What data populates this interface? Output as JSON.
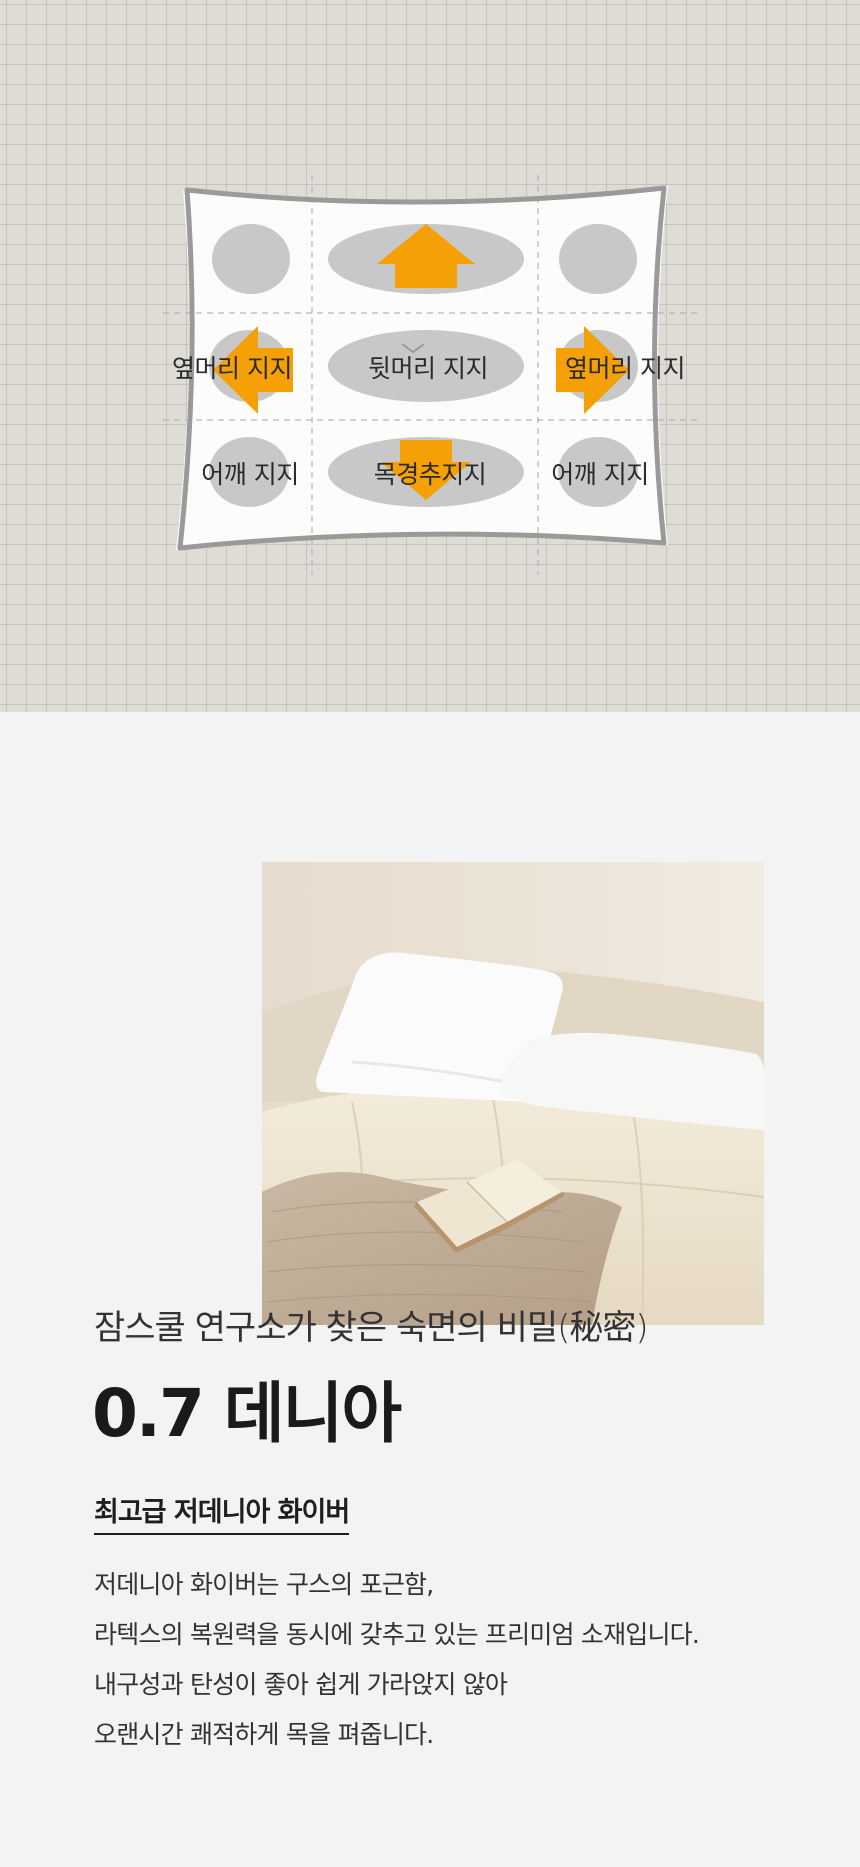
{
  "diagram": {
    "labels": {
      "side_left": "옆머리 지지",
      "back_head": "뒷머리 지지",
      "side_right": "옆머리 지지",
      "shoulder_left": "어깨 지지",
      "neck": "목경추지지",
      "shoulder_right": "어깨 지지"
    },
    "colors": {
      "arrow": "#f5a006",
      "zone": "#c8c8c8",
      "outline": "#9a9a9a"
    }
  },
  "subtitle": "잠스쿨 연구소가 찾은 숙면의 비밀(秘密)",
  "title": "0.7 데니아",
  "section_label": "최고급 저데니아 화이버",
  "body_lines": [
    "저데니아 화이버는 구스의 포근함,",
    "라텍스의 복원력을 동시에 갖추고 있는 프리미엄 소재입니다.",
    "내구성과 탄성이 좋아 쉽게 가라앉지 않아",
    "오랜시간 쾌적하게 목을 펴줍니다."
  ]
}
